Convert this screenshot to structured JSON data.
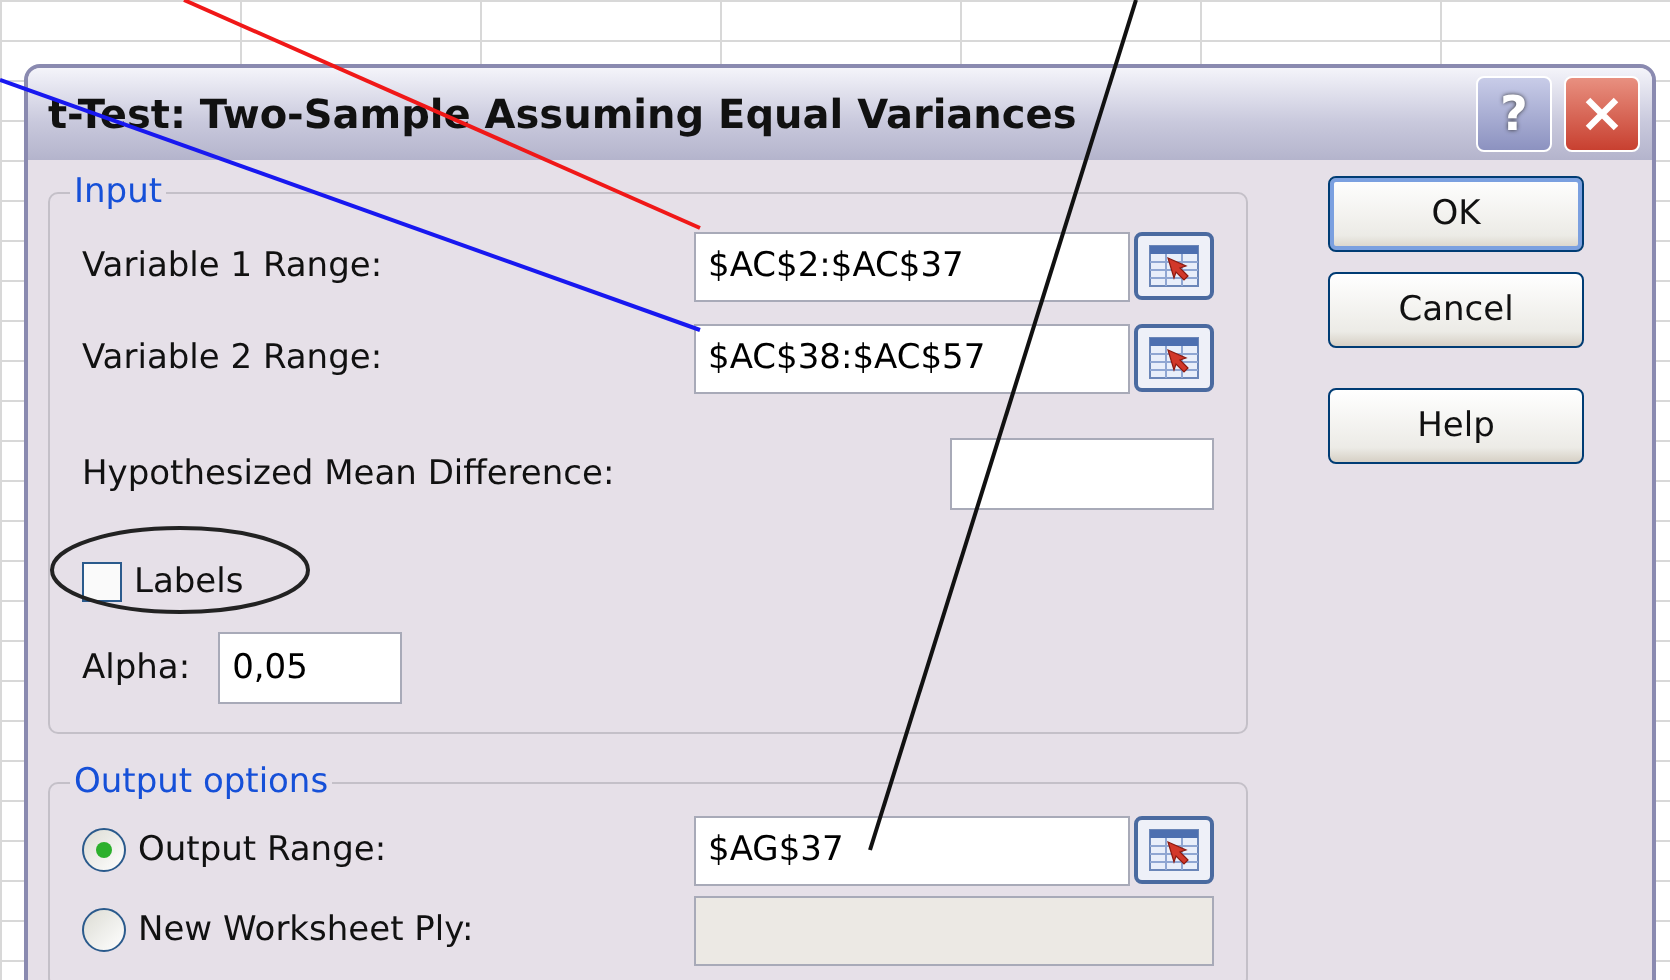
{
  "window": {
    "title": "t-Test: Two-Sample Assuming Equal Variances"
  },
  "title_buttons": [
    {
      "kind": "help",
      "label": "?"
    },
    {
      "kind": "close"
    }
  ],
  "input": {
    "legend": "Input",
    "ranges": [
      {
        "label": "Variable 1 Range:",
        "value": "$AC$2:$AC$37"
      },
      {
        "label": "Variable 2 Range:",
        "value": "$AC$38:$AC$57"
      }
    ],
    "mean_difference": {
      "label": "Hypothesized Mean Difference:"
    },
    "labels": {
      "label": "Labels",
      "checked": false
    },
    "alpha": {
      "label": "Alpha:",
      "value": "0,05"
    }
  },
  "output": {
    "legend": "Output options",
    "options": [
      {
        "label": "Output Range:",
        "selected": true,
        "value": "$AG$37",
        "disabled": false
      },
      {
        "label": "New Worksheet Ply:",
        "selected": false,
        "disabled": true
      }
    ]
  },
  "buttons": [
    {
      "label": "OK",
      "default": true
    },
    {
      "label": "Cancel",
      "default": false
    },
    {
      "label": "Help",
      "default": false
    }
  ]
}
